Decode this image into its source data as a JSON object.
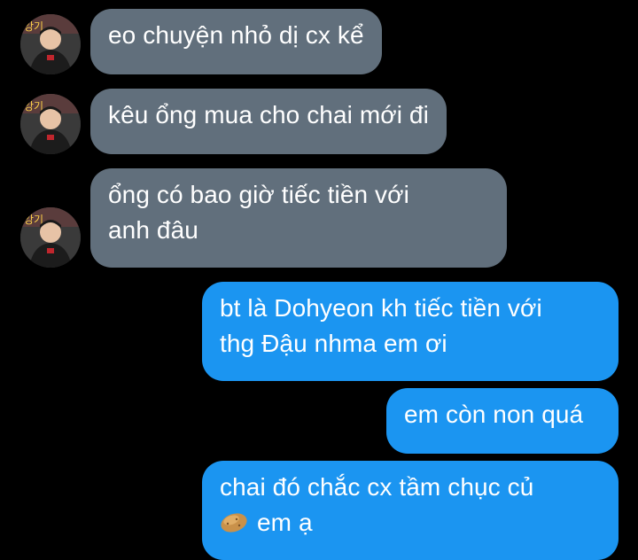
{
  "conversation": {
    "messages": [
      {
        "direction": "incoming",
        "text": "eo chuyện nhỏ dị cx kể"
      },
      {
        "direction": "incoming",
        "text": "kêu ổng mua cho chai mới đi"
      },
      {
        "direction": "incoming",
        "lines": [
          "ổng có bao giờ tiếc tiền với",
          "anh đâu"
        ]
      },
      {
        "direction": "outgoing",
        "lines": [
          "bt là Dohyeon kh tiếc tiền với",
          "thg Đậu nhma em ơi"
        ]
      },
      {
        "direction": "outgoing",
        "text": "em còn non quá"
      },
      {
        "direction": "outgoing",
        "lines": [
          "chai đó chắc cx tầm chục củ",
          "em ạ"
        ],
        "emoji": "potato-emoji"
      }
    ]
  },
  "colors": {
    "background": "#000000",
    "incoming_bubble": "#616f7c",
    "outgoing_bubble": "#1b95f1",
    "text": "#ffffff"
  }
}
